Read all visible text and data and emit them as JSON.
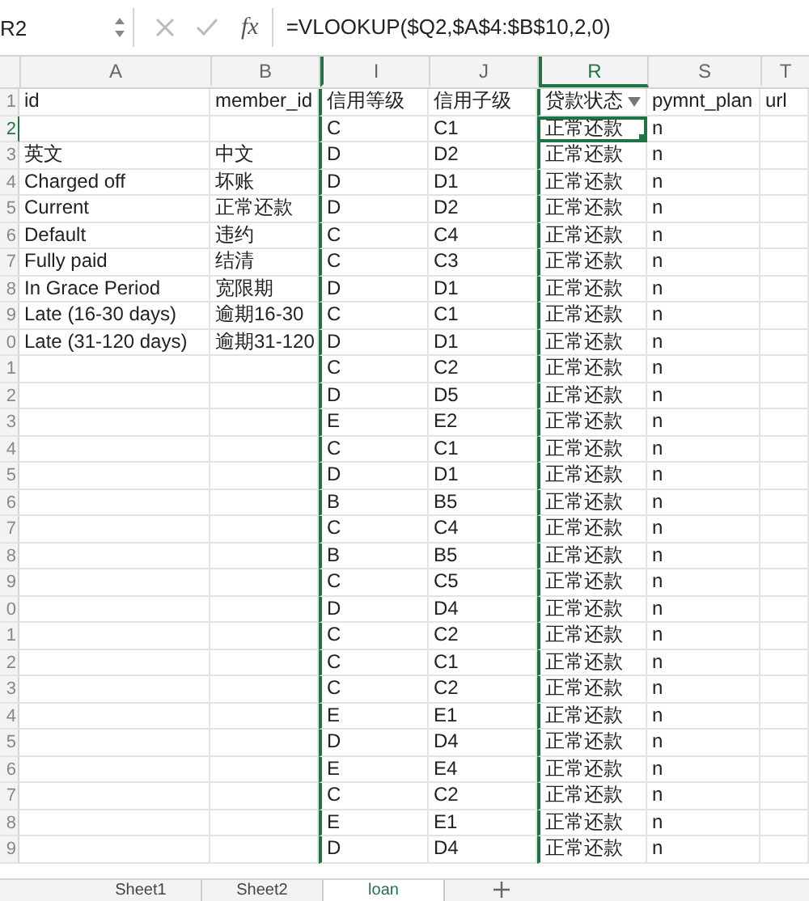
{
  "name_box": "R2",
  "function_label": "fx",
  "formula": "=VLOOKUP($Q2,$A$4:$B$10,2,0)",
  "columns": [
    {
      "label": "A",
      "selected": false
    },
    {
      "label": "B",
      "selected": false
    },
    {
      "label": "I",
      "selected": false
    },
    {
      "label": "J",
      "selected": false
    },
    {
      "label": "R",
      "selected": true
    },
    {
      "label": "S",
      "selected": false
    },
    {
      "label": "T",
      "selected": false
    }
  ],
  "rows": [
    {
      "num": "1",
      "selected": false,
      "cells": [
        "id",
        "member_id",
        "信用等级",
        "信用子级",
        "贷款状态",
        "pymnt_plan",
        "url"
      ]
    },
    {
      "num": "2",
      "selected": true,
      "cells": [
        "",
        "",
        "C",
        "C1",
        "正常还款",
        "n",
        ""
      ]
    },
    {
      "num": "3",
      "selected": false,
      "cells": [
        "英文",
        "中文",
        "D",
        "D2",
        "正常还款",
        "n",
        ""
      ]
    },
    {
      "num": "4",
      "selected": false,
      "cells": [
        "Charged off",
        "坏账",
        "D",
        "D1",
        "正常还款",
        "n",
        ""
      ]
    },
    {
      "num": "5",
      "selected": false,
      "cells": [
        "Current",
        "正常还款",
        "D",
        "D2",
        "正常还款",
        "n",
        ""
      ]
    },
    {
      "num": "6",
      "selected": false,
      "cells": [
        "Default",
        "违约",
        "C",
        "C4",
        "正常还款",
        "n",
        ""
      ]
    },
    {
      "num": "7",
      "selected": false,
      "cells": [
        "Fully paid",
        "结清",
        "C",
        "C3",
        "正常还款",
        "n",
        ""
      ]
    },
    {
      "num": "8",
      "selected": false,
      "cells": [
        "In Grace Period",
        "宽限期",
        "D",
        "D1",
        "正常还款",
        "n",
        ""
      ]
    },
    {
      "num": "9",
      "selected": false,
      "cells": [
        "Late (16-30 days)",
        "逾期16-30",
        "C",
        "C1",
        "正常还款",
        "n",
        ""
      ]
    },
    {
      "num": "0",
      "selected": false,
      "cells": [
        "Late (31-120 days)",
        "逾期31-120",
        "D",
        "D1",
        "正常还款",
        "n",
        ""
      ]
    },
    {
      "num": "1",
      "selected": false,
      "cells": [
        "",
        "",
        "C",
        "C2",
        "正常还款",
        "n",
        ""
      ]
    },
    {
      "num": "2",
      "selected": false,
      "cells": [
        "",
        "",
        "D",
        "D5",
        "正常还款",
        "n",
        ""
      ]
    },
    {
      "num": "3",
      "selected": false,
      "cells": [
        "",
        "",
        "E",
        "E2",
        "正常还款",
        "n",
        ""
      ]
    },
    {
      "num": "4",
      "selected": false,
      "cells": [
        "",
        "",
        "C",
        "C1",
        "正常还款",
        "n",
        ""
      ]
    },
    {
      "num": "5",
      "selected": false,
      "cells": [
        "",
        "",
        "D",
        "D1",
        "正常还款",
        "n",
        ""
      ]
    },
    {
      "num": "6",
      "selected": false,
      "cells": [
        "",
        "",
        "B",
        "B5",
        "正常还款",
        "n",
        ""
      ]
    },
    {
      "num": "7",
      "selected": false,
      "cells": [
        "",
        "",
        "C",
        "C4",
        "正常还款",
        "n",
        ""
      ]
    },
    {
      "num": "8",
      "selected": false,
      "cells": [
        "",
        "",
        "B",
        "B5",
        "正常还款",
        "n",
        ""
      ]
    },
    {
      "num": "9",
      "selected": false,
      "cells": [
        "",
        "",
        "C",
        "C5",
        "正常还款",
        "n",
        ""
      ]
    },
    {
      "num": "0",
      "selected": false,
      "cells": [
        "",
        "",
        "D",
        "D4",
        "正常还款",
        "n",
        ""
      ]
    },
    {
      "num": "1",
      "selected": false,
      "cells": [
        "",
        "",
        "C",
        "C2",
        "正常还款",
        "n",
        ""
      ]
    },
    {
      "num": "2",
      "selected": false,
      "cells": [
        "",
        "",
        "C",
        "C1",
        "正常还款",
        "n",
        ""
      ]
    },
    {
      "num": "3",
      "selected": false,
      "cells": [
        "",
        "",
        "C",
        "C2",
        "正常还款",
        "n",
        ""
      ]
    },
    {
      "num": "4",
      "selected": false,
      "cells": [
        "",
        "",
        "E",
        "E1",
        "正常还款",
        "n",
        ""
      ]
    },
    {
      "num": "5",
      "selected": false,
      "cells": [
        "",
        "",
        "D",
        "D4",
        "正常还款",
        "n",
        ""
      ]
    },
    {
      "num": "6",
      "selected": false,
      "cells": [
        "",
        "",
        "E",
        "E4",
        "正常还款",
        "n",
        ""
      ]
    },
    {
      "num": "7",
      "selected": false,
      "cells": [
        "",
        "",
        "C",
        "C2",
        "正常还款",
        "n",
        ""
      ]
    },
    {
      "num": "8",
      "selected": false,
      "cells": [
        "",
        "",
        "E",
        "E1",
        "正常还款",
        "n",
        ""
      ]
    },
    {
      "num": "9",
      "selected": false,
      "cells": [
        "",
        "",
        "D",
        "D4",
        "正常还款",
        "n",
        ""
      ]
    }
  ],
  "sheet_tabs": [
    {
      "label": "Sheet1",
      "selected": false
    },
    {
      "label": "Sheet2",
      "selected": false
    },
    {
      "label": "loan",
      "selected": true
    }
  ]
}
